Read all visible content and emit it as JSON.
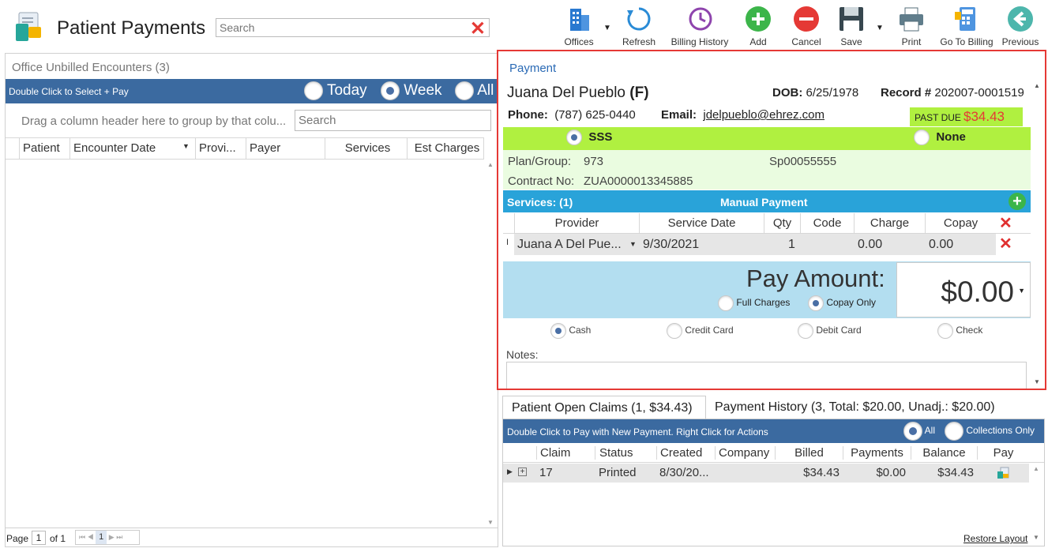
{
  "app": {
    "title": "Patient Payments",
    "search_placeholder": "Search"
  },
  "toolbar": {
    "offices": "Offices",
    "refresh": "Refresh",
    "billing_history": "Billing History",
    "add": "Add",
    "cancel": "Cancel",
    "save": "Save",
    "print": "Print",
    "go_to_billing": "Go To Billing",
    "previous": "Previous"
  },
  "left": {
    "section_title": "Office Unbilled Encounters (3)",
    "bar_text": "Double Click to Select + Pay",
    "filters": [
      "Today",
      "Week",
      "All"
    ],
    "selected_filter": "Week",
    "group_hint": "Drag a column header here to group by that colu...",
    "search_placeholder": "Search",
    "columns": [
      "Patient",
      "Encounter Date",
      "Provi...",
      "Payer",
      "Services",
      "Est Charges"
    ],
    "pager": {
      "page_label": "Page",
      "page": "1",
      "of_label": "of 1",
      "current": "1"
    }
  },
  "payment": {
    "section_title": "Payment",
    "patient_name": "Juana Del Pueblo",
    "sex": "(F)",
    "dob_label": "DOB:",
    "dob": "6/25/1978",
    "record_label": "Record #",
    "record": "202007-0001519",
    "phone_label": "Phone:",
    "phone": "(787) 625-0440",
    "email_label": "Email:",
    "email": "jdelpueblo@ehrez.com",
    "past_due_label": "PAST DUE",
    "past_due": "$34.43",
    "insurance": "SSS",
    "insurance_none": "None",
    "plan_label": "Plan/Group:",
    "plan": "973",
    "plan_code": "Sp00055555",
    "contract_label": "Contract No:",
    "contract": "ZUA0000013345885",
    "services_label": "Services: (1)",
    "manual_payment": "Manual Payment",
    "svc_columns": [
      "Provider",
      "Service Date",
      "Qty",
      "Code",
      "Charge",
      "Copay"
    ],
    "svc_row": {
      "provider": "Juana A Del Pue...",
      "date": "9/30/2021",
      "qty": "1",
      "code": "",
      "charge": "0.00",
      "copay": "0.00"
    },
    "pay_amount_label": "Pay Amount:",
    "pay_amount": "$0.00",
    "full_charges": "Full Charges",
    "copay_only": "Copay Only",
    "methods": [
      "Cash",
      "Credit Card",
      "Debit Card",
      "Check"
    ],
    "selected_method": "Cash",
    "notes_label": "Notes:"
  },
  "bottom": {
    "tab_claims": "Patient Open Claims (1, $34.43)",
    "tab_history": "Payment History (3, Total: $20.00, Unadj.: $20.00)",
    "bar_text": "Double Click to Pay with New Payment. Right Click for Actions",
    "filter_all": "All",
    "filter_collections": "Collections Only",
    "columns": [
      "Claim",
      "Status",
      "Created",
      "Company",
      "Billed",
      "Payments",
      "Balance",
      "Pay"
    ],
    "row": {
      "claim": "17",
      "status": "Printed",
      "created": "8/30/20...",
      "company": "",
      "billed": "$34.43",
      "payments": "$0.00",
      "balance": "$34.43"
    },
    "restore_layout": "Restore Layout"
  },
  "colors": {
    "blue_bar": "#3b6aa0",
    "lime": "#b0f040",
    "light_green": "#eafce0",
    "services_blue": "#29a3d9",
    "pay_bg": "#b3def0",
    "red_border": "#e53935"
  }
}
